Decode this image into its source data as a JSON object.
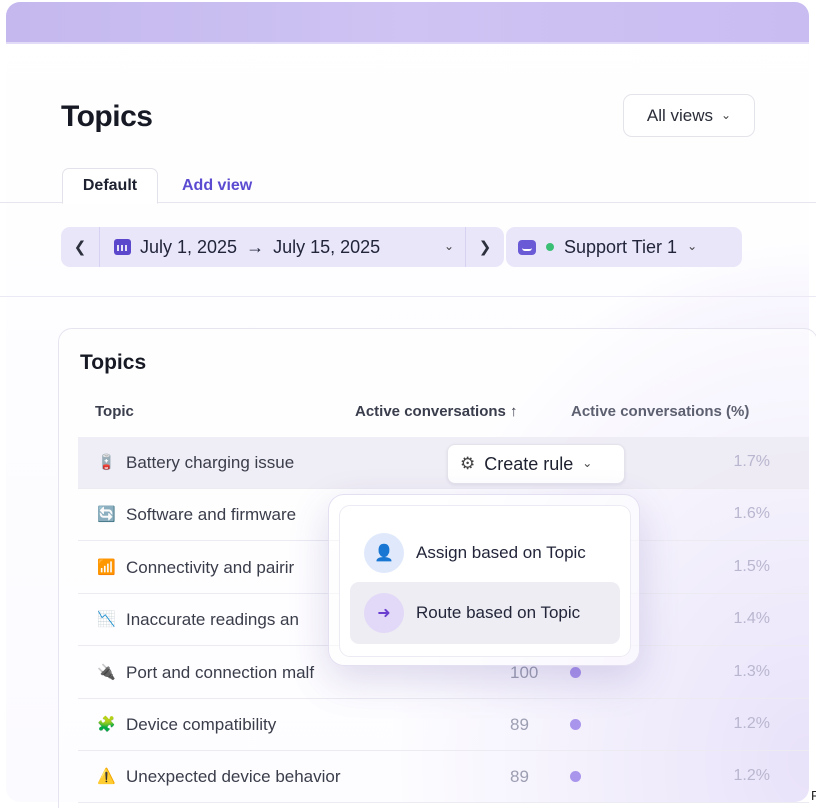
{
  "header": {
    "title": "Topics",
    "views_button": "All views"
  },
  "tabs": [
    {
      "label": "Default",
      "active": true
    },
    {
      "label": "Add view",
      "active": false
    }
  ],
  "filters": {
    "date_start": "July 1, 2025",
    "date_arrow": "→",
    "date_end": "July 15, 2025",
    "team": "Support Tier 1",
    "team_status_color": "#3bbf75"
  },
  "card": {
    "title": "Topics",
    "columns": {
      "topic": "Topic",
      "active": "Active conversations ↑",
      "active_pct": "Active conversations (%)"
    },
    "rows": [
      {
        "icon": "battery-icon",
        "glyph": "🪫",
        "name": "Battery charging issue",
        "value": "",
        "pct": "1.7%"
      },
      {
        "icon": "refresh-icon",
        "glyph": "🔄",
        "name": "Software and firmware",
        "value": "",
        "pct": "1.6%"
      },
      {
        "icon": "signal-icon",
        "glyph": "📶",
        "name": "Connectivity and pairir",
        "value": "",
        "pct": "1.5%"
      },
      {
        "icon": "chart-down-icon",
        "glyph": "📉",
        "name": "Inaccurate readings an",
        "value": "",
        "pct": "1.4%"
      },
      {
        "icon": "plug-icon",
        "glyph": "🔌",
        "name": "Port and connection malf",
        "value": "100",
        "pct": "1.3%"
      },
      {
        "icon": "puzzle-icon",
        "glyph": "🧩",
        "name": "Device compatibility",
        "value": "89",
        "pct": "1.2%"
      },
      {
        "icon": "warning-icon",
        "glyph": "⚠️",
        "name": "Unexpected device behavior",
        "value": "89",
        "pct": "1.2%"
      }
    ]
  },
  "create_rule": {
    "label": "Create rule"
  },
  "menu": {
    "assign": "Assign based on Topic",
    "route": "Route based on Topic"
  },
  "edge_letter": "F",
  "colors": {
    "accent": "#5b4bd1",
    "topbar": "#c9bcf1"
  }
}
